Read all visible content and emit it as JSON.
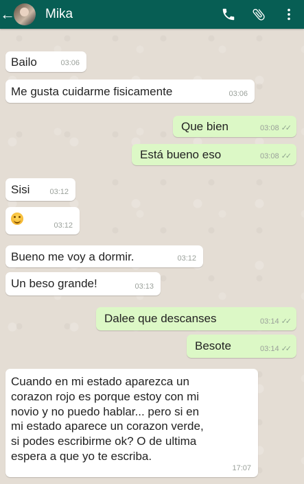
{
  "header": {
    "back_glyph": "←",
    "contact_name": "Mika",
    "icons": [
      "phone-icon",
      "paperclip-icon",
      "more-vert-icon"
    ]
  },
  "colors": {
    "appbar": "#075e54",
    "incoming": "#ffffff",
    "outgoing": "#dcf8c6",
    "background": "#e4ddd4"
  },
  "messages": [
    {
      "dir": "in",
      "text": "Bailo",
      "time": "03:06"
    },
    {
      "dir": "in",
      "text": "Me gusta cuidarme fisicamente",
      "time": "03:06"
    },
    {
      "dir": "out",
      "text": "Que bien",
      "time": "03:08",
      "ticks": "✓✓"
    },
    {
      "dir": "out",
      "text": "Está bueno eso",
      "time": "03:08",
      "ticks": "✓✓"
    },
    {
      "dir": "in",
      "text": "Sisi",
      "time": "03:12"
    },
    {
      "dir": "in",
      "text": "",
      "emoji": "smiling-face-emoji",
      "time": "03:12"
    },
    {
      "dir": "in",
      "text": "Bueno me voy a dormir.",
      "time": "03:12"
    },
    {
      "dir": "in",
      "text": "Un beso grande!",
      "time": "03:13"
    },
    {
      "dir": "out",
      "text": "Dalee que descanses",
      "time": "03:14",
      "ticks": "✓✓"
    },
    {
      "dir": "out",
      "text": "Besote",
      "time": "03:14",
      "ticks": "✓✓"
    },
    {
      "dir": "in",
      "text": "Cuando en mi estado aparezca un\ncorazon rojo es porque estoy con mi\nnovio y no puedo hablar... pero si en\nmi estado aparece un corazon verde,\nsi podes escribirme ok? O de ultima\nespera a que yo te escriba.",
      "time": "17:07"
    }
  ]
}
